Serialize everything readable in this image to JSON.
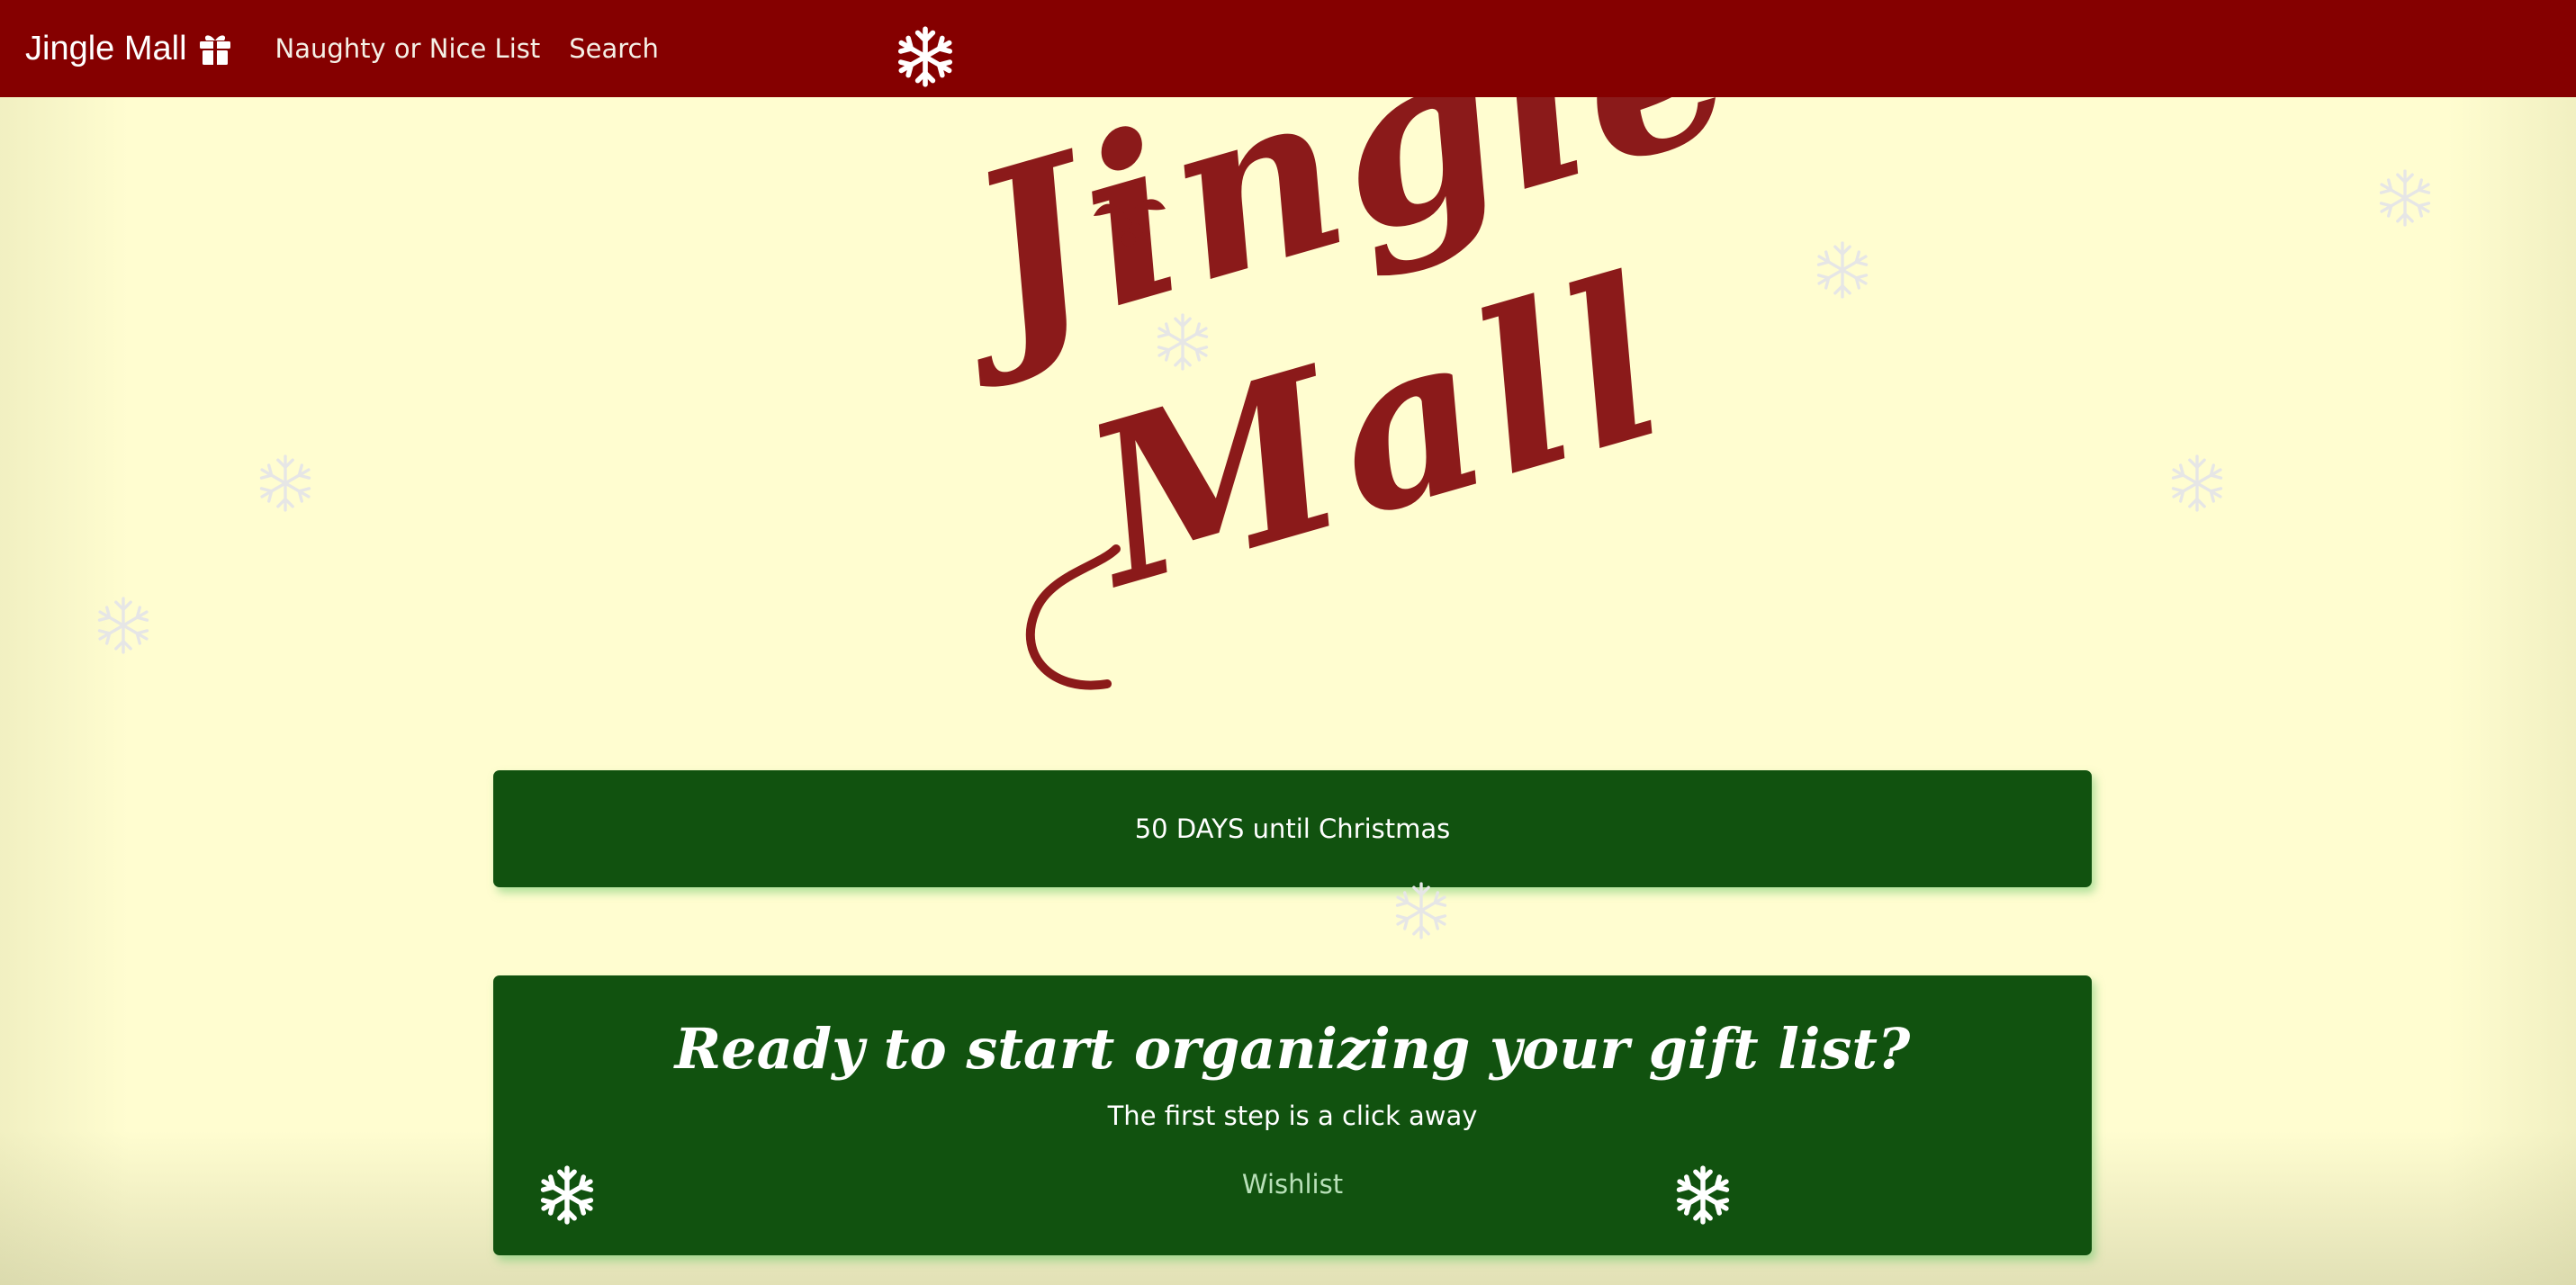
{
  "navbar": {
    "brand": "Jingle Mall",
    "brand_icon": "gift-icon",
    "links": [
      "Naughty or Nice List",
      "Search"
    ]
  },
  "hero": {
    "logo_line1": "Jingle",
    "logo_line2": "Mall"
  },
  "countdown": {
    "number": "50",
    "text": " DAYS until Christmas"
  },
  "cta": {
    "title": "Ready to start organizing your gift list?",
    "subtitle": "The first step is a click away",
    "link": "Wishlist"
  },
  "colors": {
    "navbar": "#850000",
    "background": "#fffdd0",
    "panel": "#11520f",
    "logo": "#8b1a1a"
  }
}
